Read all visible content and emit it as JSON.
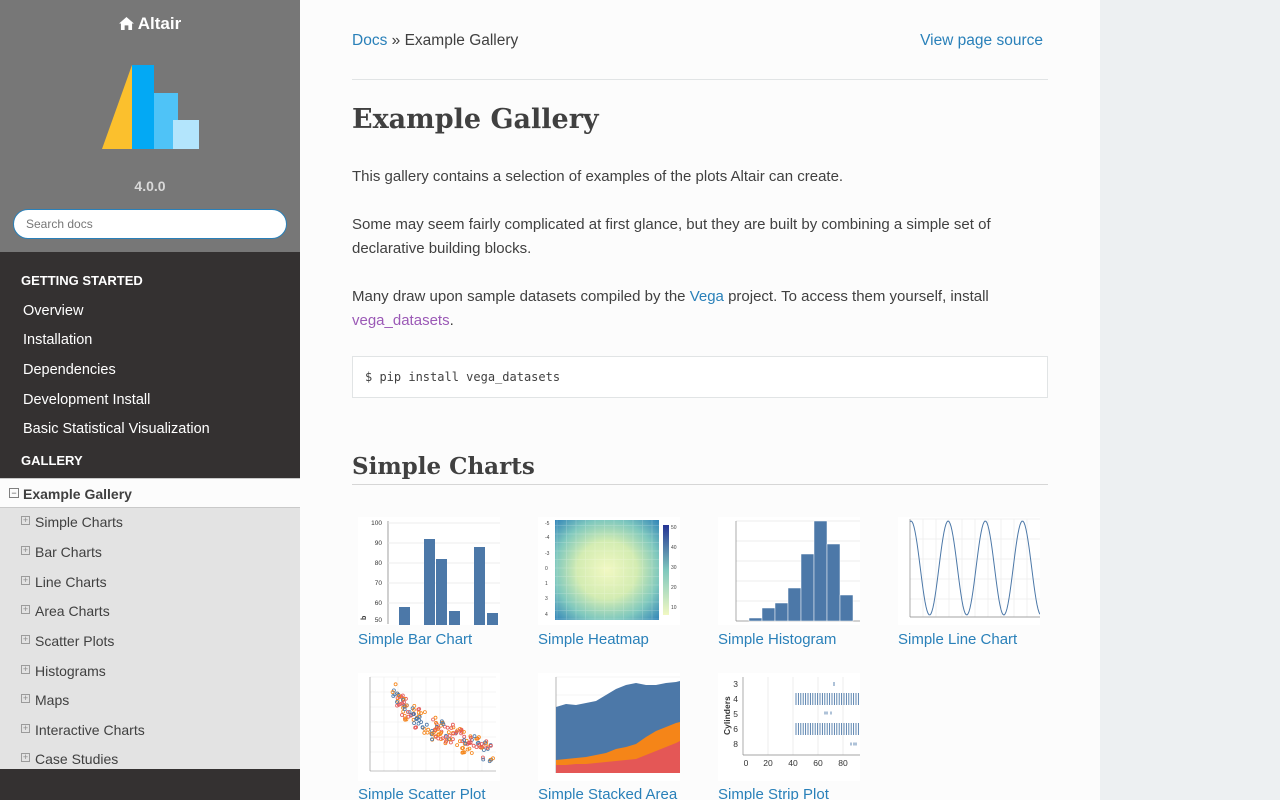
{
  "sidebar": {
    "brand": "Altair",
    "version": "4.0.0",
    "search_placeholder": "Search docs",
    "captions": [
      "Getting Started",
      "Gallery"
    ],
    "getting_started": [
      "Overview",
      "Installation",
      "Dependencies",
      "Development Install",
      "Basic Statistical Visualization"
    ],
    "current": "Example Gallery",
    "sub_items": [
      "Simple Charts",
      "Bar Charts",
      "Line Charts",
      "Area Charts",
      "Scatter Plots",
      "Histograms",
      "Maps",
      "Interactive Charts",
      "Case Studies"
    ]
  },
  "breadcrumb": {
    "docs": "Docs",
    "separator": "»",
    "current": "Example Gallery"
  },
  "view_source": "View page source",
  "title": "Example Gallery",
  "intro": "This gallery contains a selection of examples of the plots Altair can create.",
  "para2": "Some may seem fairly complicated at first glance, but they are built by combining a simple set of declarative building blocks.",
  "para3": {
    "before": "Many draw upon sample datasets compiled by the",
    "vega_link": "Vega",
    "middle": "project. To access them yourself, install",
    "datasets_link": "vega_datasets",
    "after": "."
  },
  "code": "$ pip install vega_datasets",
  "section_title": "Simple Charts",
  "gallery": [
    "Simple Bar Chart",
    "Simple Heatmap",
    "Simple Histogram",
    "Simple Line Chart",
    "Simple Scatter Plot",
    "Simple Stacked Area",
    "Simple Strip Plot"
  ],
  "thumb_axes": {
    "bar_y_ticks": [
      "100",
      "90",
      "80",
      "70",
      "60",
      "50"
    ],
    "bar_y_label": "b",
    "strip_y_ticks": [
      "3",
      "4",
      "5",
      "6",
      "8"
    ],
    "strip_x_ticks": [
      "0",
      "20",
      "40",
      "60",
      "80"
    ],
    "strip_y_label": "Cylinders"
  },
  "colors": {
    "link": "#2980b9",
    "visited_link": "#9b59b6",
    "sidebar_dark": "#343131",
    "sidebar_top": "#777777",
    "vega_blue": "#4c78a8",
    "vega_orange": "#f58518",
    "vega_red": "#e45756"
  }
}
